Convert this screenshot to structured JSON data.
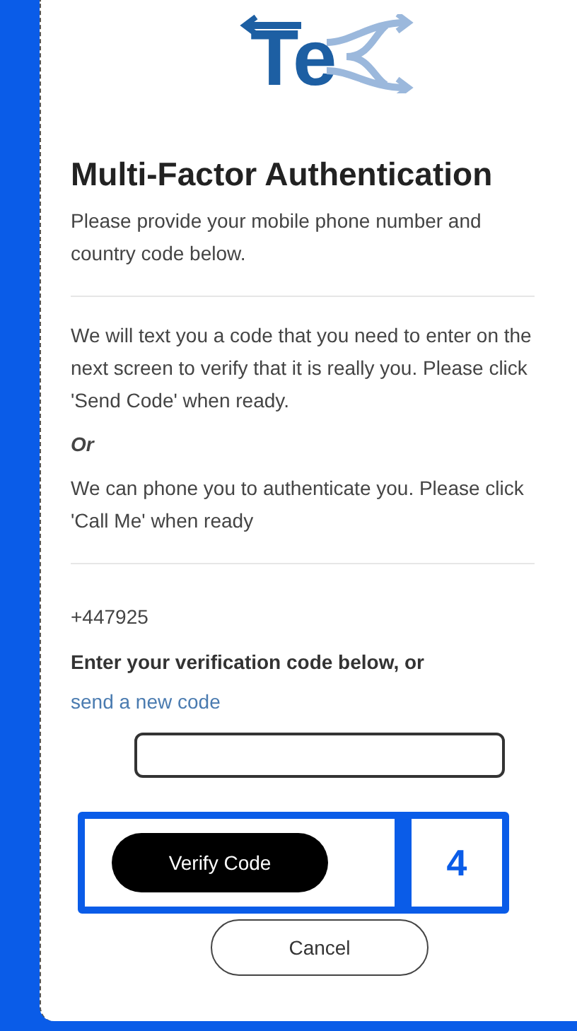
{
  "logo": {
    "text": "Te"
  },
  "title": "Multi-Factor Authentication",
  "intro": "Please provide your mobile phone number and country code below.",
  "sms_text": "We will text you a code that you need to enter on the next screen to verify that it is really you. Please click 'Send Code' when ready.",
  "or_text": "Or",
  "call_text": "We can phone you to authenticate you. Please click 'Call Me' when ready",
  "phone_number": "+447925",
  "code_label": "Enter your verification code below, or ",
  "resend_link": "send a new code",
  "verify_button": "Verify Code",
  "callout": {
    "step": "4"
  },
  "cancel_button": "Cancel"
}
